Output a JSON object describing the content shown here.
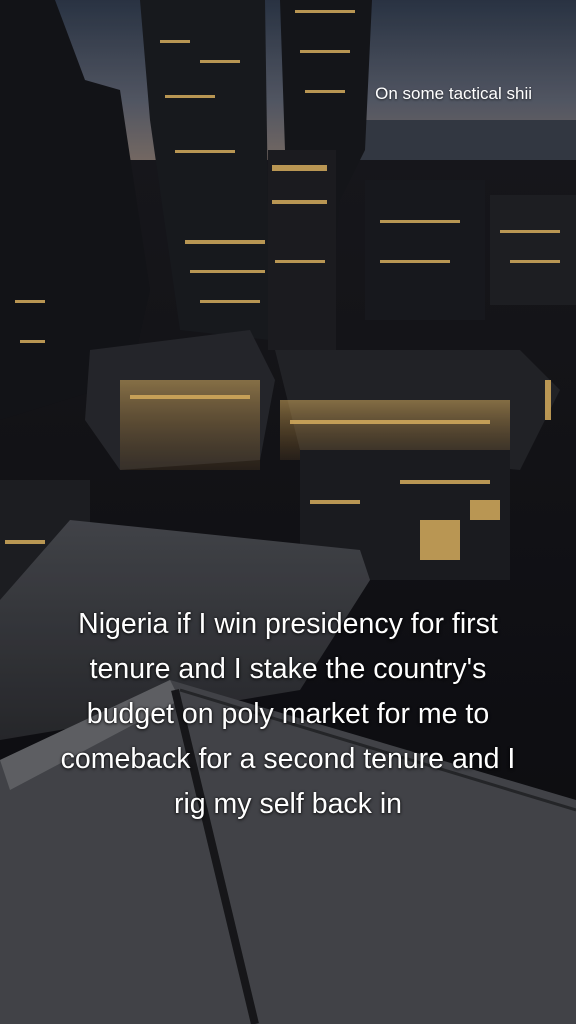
{
  "overlay": {
    "top_caption": "On some tactical shii",
    "caption_lines": [
      "Nigeria if I win presidency for  first",
      "tenure and I stake the country's",
      "budget on poly market for me to",
      "comeback for a second tenure and I",
      "rig my self back in"
    ]
  },
  "colors": {
    "sky_top": "#3a4658",
    "sky_horizon": "#7a7070",
    "window_light": "#f3c46a",
    "rooftop": "#3b3c40"
  }
}
